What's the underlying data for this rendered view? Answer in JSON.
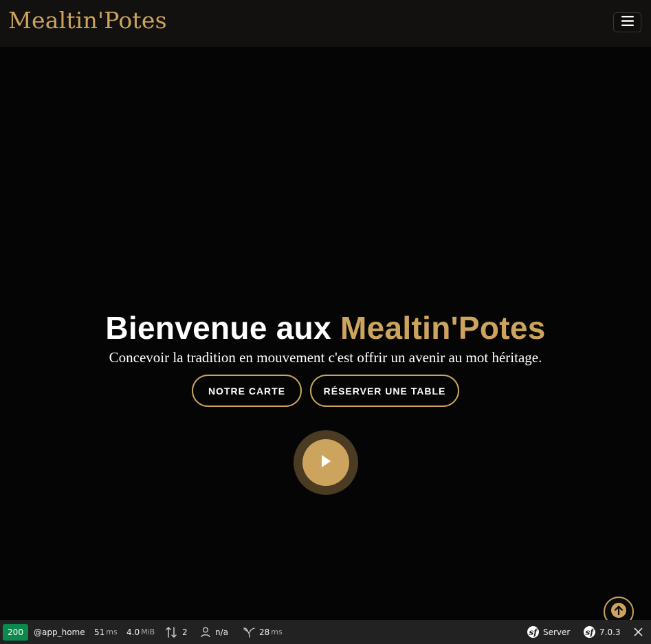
{
  "header": {
    "logo_text": "Mealtin'Potes",
    "menu_toggle_icon": "hamburger-icon"
  },
  "hero": {
    "title_prefix": "Bienvenue aux ",
    "title_accent": "Mealtin'Potes",
    "subtitle": "Concevoir la tradition en mouvement c'est offrir un avenir au mot héritage.",
    "buttons": {
      "menu_label": "NOTRE CARTE",
      "book_label": "RÉSERVER UNE TABLE"
    },
    "play_icon": "play-icon"
  },
  "back_to_top_icon": "arrow-up-icon",
  "debug_toolbar": {
    "status_code": "200",
    "route": "@app_home",
    "time_value": "51",
    "time_unit": "ms",
    "memory_value": "4.0",
    "memory_unit": "MiB",
    "requests_count": "2",
    "user": "n/a",
    "twig_value": "28",
    "twig_unit": "ms",
    "server_label": "Server",
    "version": "7.0.3"
  },
  "colors": {
    "accent": "#cda45e",
    "background": "#050505",
    "navbar": "#121110",
    "toolbar": "#222222",
    "status_ok": "#0b8a4b"
  }
}
